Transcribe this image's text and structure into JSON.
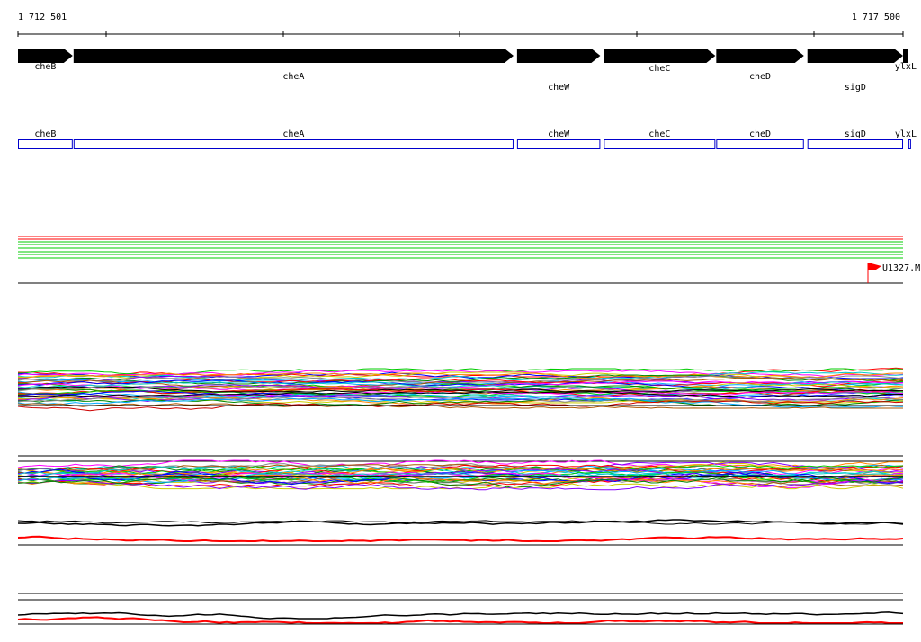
{
  "ruler": {
    "start_label": "1 712 501",
    "end_label": "1 717 500",
    "start": 1712501,
    "end": 1717500
  },
  "genes": [
    {
      "name": "cheB",
      "start": 1712501,
      "end": 1712810,
      "strand": "+"
    },
    {
      "name": "cheA",
      "start": 1712815,
      "end": 1715300,
      "strand": "+"
    },
    {
      "name": "cheW",
      "start": 1715320,
      "end": 1715790,
      "strand": "+"
    },
    {
      "name": "cheC",
      "start": 1715810,
      "end": 1716440,
      "strand": "+"
    },
    {
      "name": "cheD",
      "start": 1716445,
      "end": 1716940,
      "strand": "+"
    },
    {
      "name": "sigD",
      "start": 1716960,
      "end": 1717725,
      "strand": "+"
    },
    {
      "name": "ylxL",
      "start": 1717530,
      "end": 1717500,
      "strand": "+"
    }
  ],
  "marker": {
    "label": "U1327.M"
  },
  "colors": {
    "gene_arrow": "#000000",
    "gene_box": "#0000cc",
    "marker_flag": "#ff0000",
    "track_red": "#ff0000",
    "track_green": "#00cc00",
    "baseline": "#000000"
  }
}
